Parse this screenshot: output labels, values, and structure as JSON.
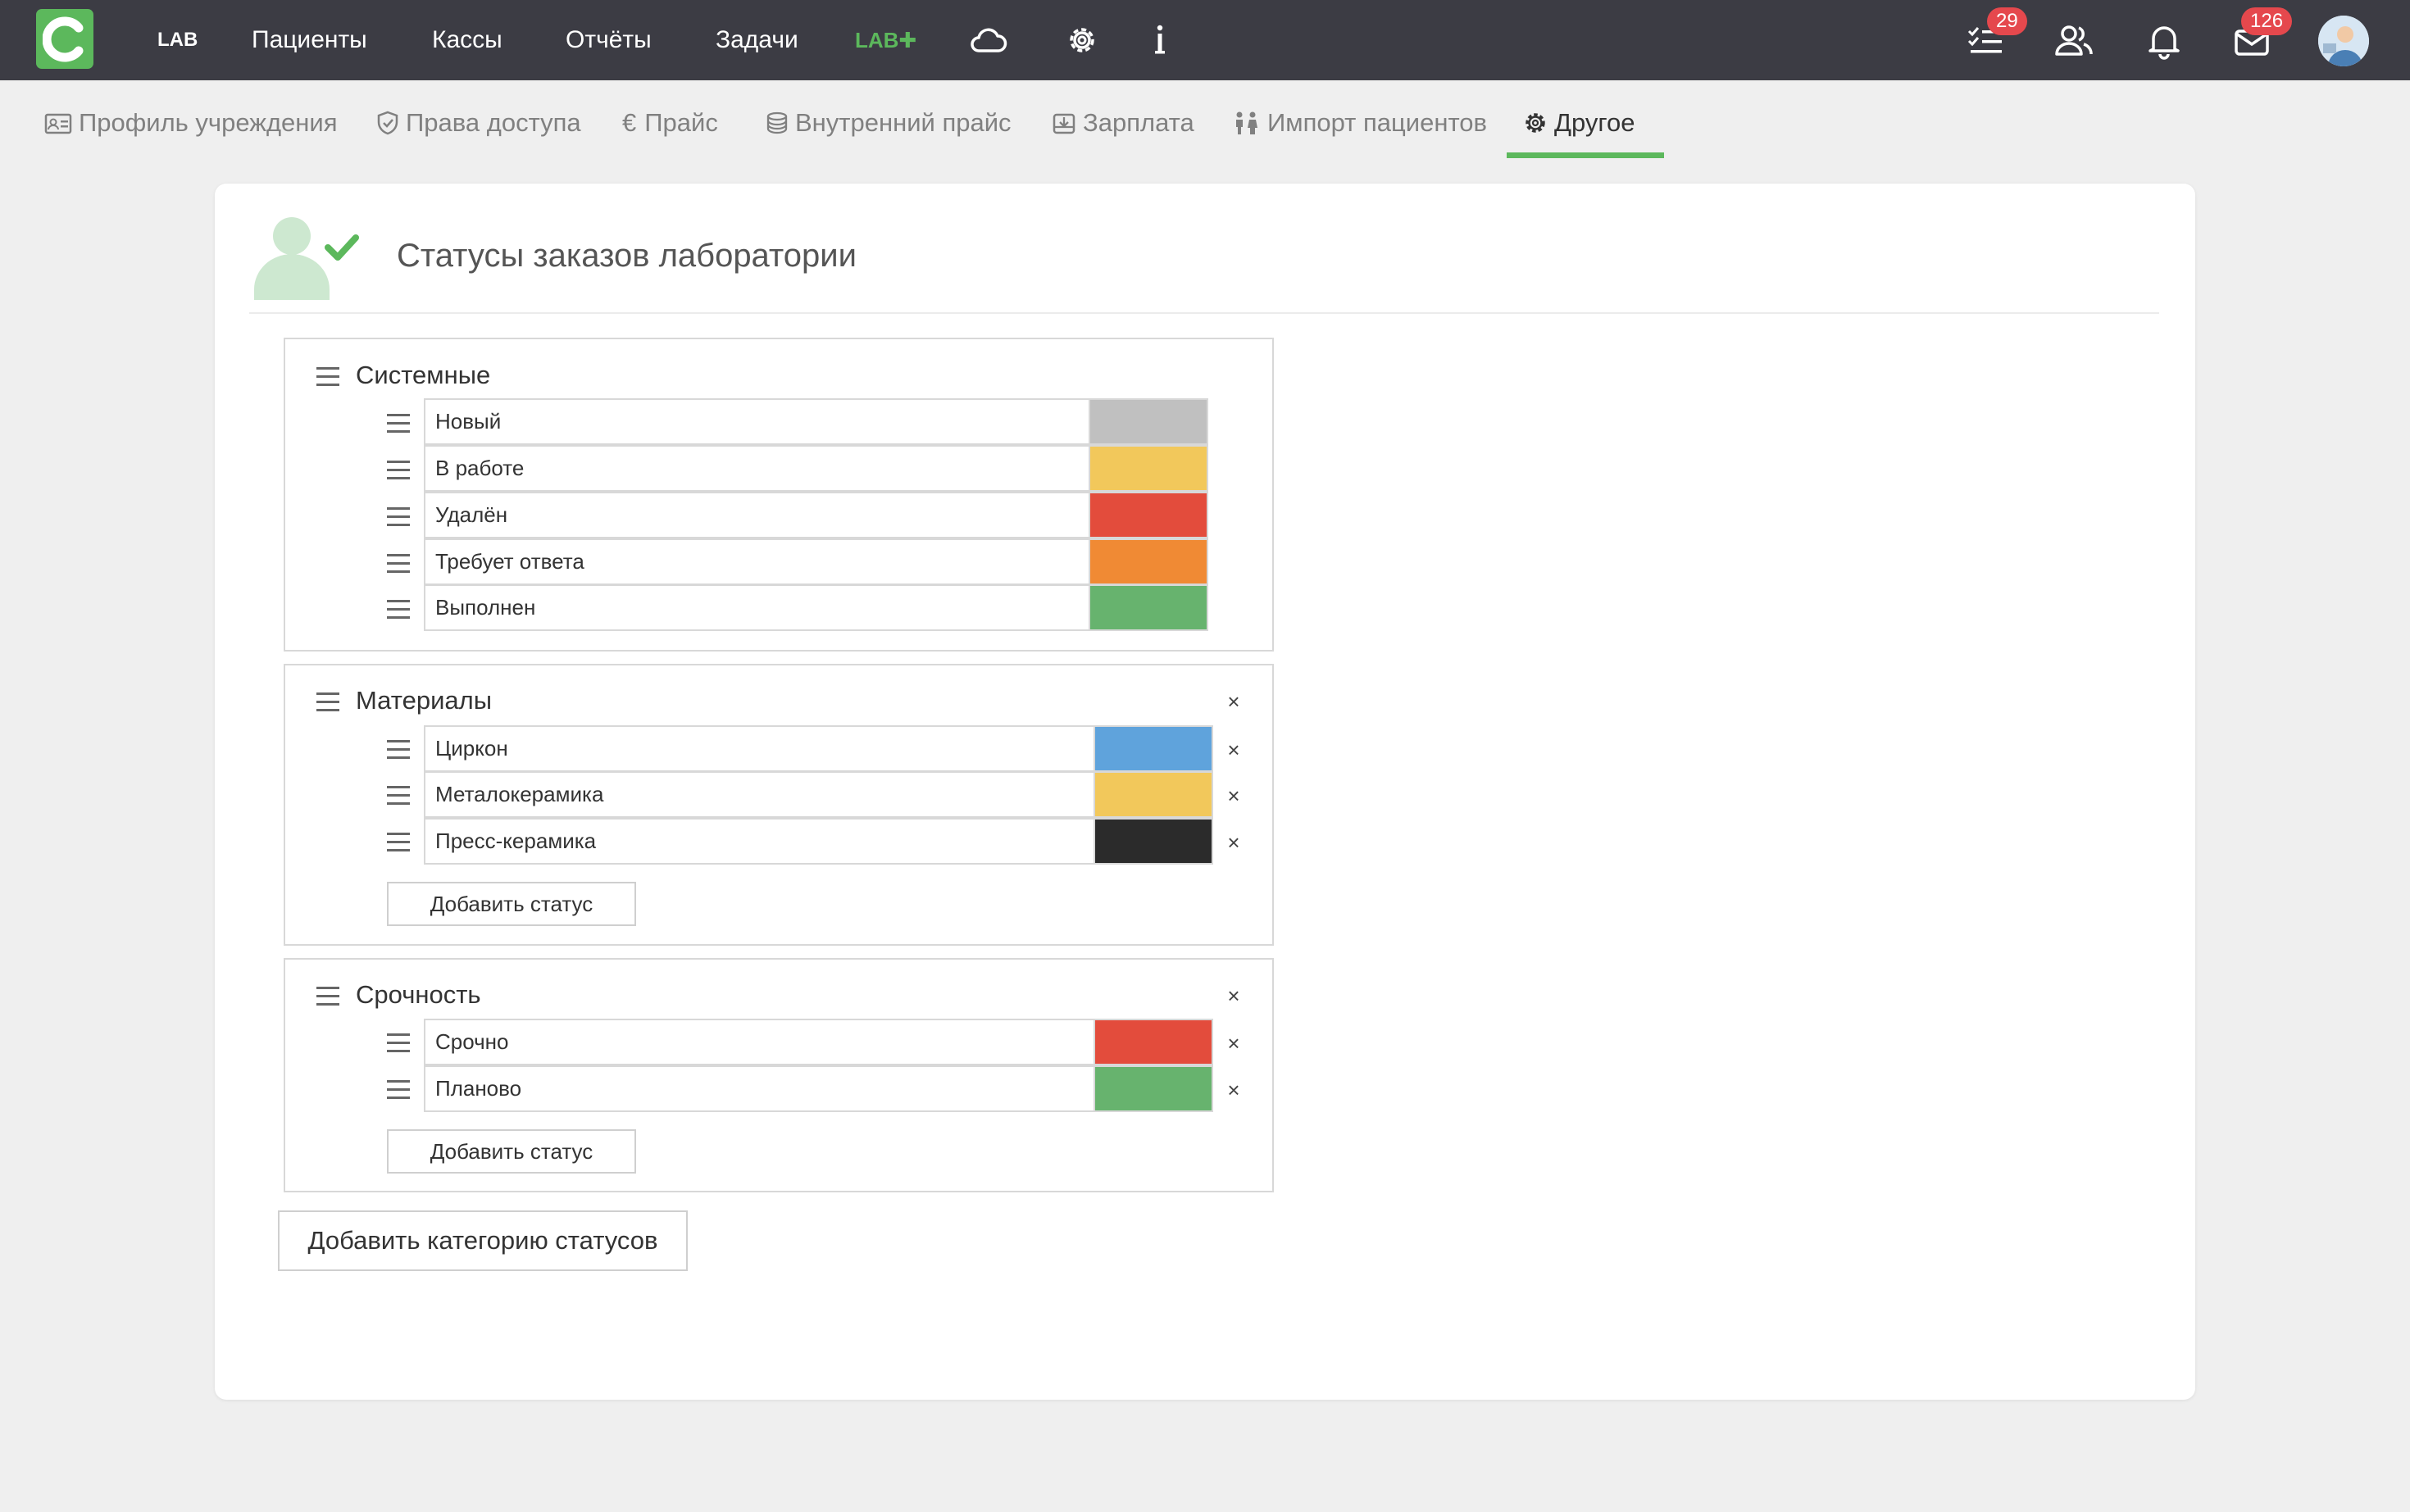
{
  "topbar": {
    "nav": [
      "LAB",
      "Пациенты",
      "Кассы",
      "Отчёты",
      "Задачи",
      "LAB✚"
    ],
    "tasks_badge": "29",
    "mail_badge": "126",
    "icons": [
      "cloud-icon",
      "gear-icon",
      "info-icon",
      "tasks-list-icon",
      "users-icon",
      "bell-icon",
      "mail-icon"
    ]
  },
  "tabs": [
    {
      "label": "Профиль учреждения",
      "icon": "id-card-icon"
    },
    {
      "label": "Права доступа",
      "icon": "shield-icon"
    },
    {
      "label": "Прайс",
      "icon": "euro-icon"
    },
    {
      "label": "Внутренний прайс",
      "icon": "coins-icon"
    },
    {
      "label": "Зарплата",
      "icon": "wallet-icon"
    },
    {
      "label": "Импорт пациентов",
      "icon": "people-icon"
    },
    {
      "label": "Другое",
      "icon": "gear-icon",
      "active": true
    }
  ],
  "page": {
    "title": "Статусы заказов лаборатории"
  },
  "groups": [
    {
      "title": "Системные",
      "removable": false,
      "statuses": [
        {
          "label": "Новый",
          "color": "#c0c0c0"
        },
        {
          "label": "В работе",
          "color": "#f2c85b"
        },
        {
          "label": "Удалён",
          "color": "#e34c3c"
        },
        {
          "label": "Требует ответа",
          "color": "#f08a34"
        },
        {
          "label": "Выполнен",
          "color": "#67b36e"
        }
      ]
    },
    {
      "title": "Материалы",
      "removable": true,
      "statuses": [
        {
          "label": "Циркон",
          "color": "#5fa3dc"
        },
        {
          "label": "Металокерамика",
          "color": "#f2c85b"
        },
        {
          "label": "Пресс-керамика",
          "color": "#2b2b2b"
        }
      ],
      "add_label": "Добавить статус"
    },
    {
      "title": "Срочность",
      "removable": true,
      "statuses": [
        {
          "label": "Срочно",
          "color": "#e34c3c"
        },
        {
          "label": "Планово",
          "color": "#67b36e"
        }
      ],
      "add_label": "Добавить статус"
    }
  ],
  "add_category_label": "Добавить категорию статусов",
  "close_glyph": "×",
  "colors": {
    "accent": "#5cb85c",
    "topbar": "#3c3c44",
    "badge": "#e5484d"
  }
}
